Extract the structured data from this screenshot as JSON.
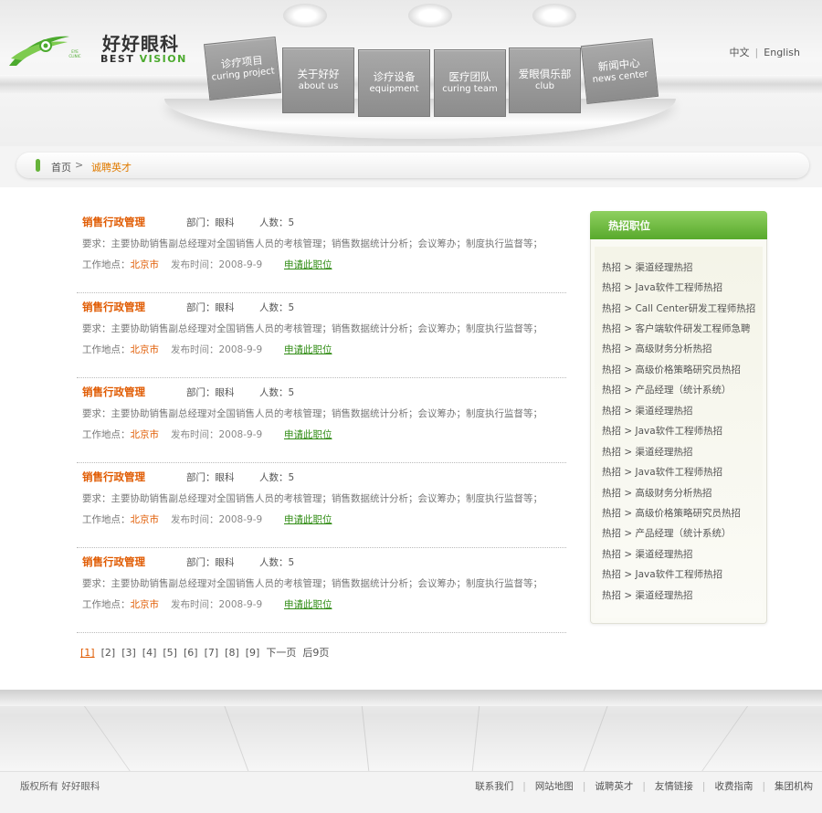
{
  "brand": {
    "name_cn": "好好眼科",
    "name_en_prefix": "BEST ",
    "name_en_accent": "VISION",
    "tiny_mark": "EYE CLINIC"
  },
  "language": {
    "cn": "中文",
    "en": "English",
    "separator": "|"
  },
  "nav": [
    {
      "cn": "诊疗项目",
      "en": "curing project"
    },
    {
      "cn": "关于好好",
      "en": "about us"
    },
    {
      "cn": "诊疗设备",
      "en": "equipment"
    },
    {
      "cn": "医疗团队",
      "en": "curing team"
    },
    {
      "cn": "爱眼俱乐部",
      "en": "club"
    },
    {
      "cn": "新闻中心",
      "en": "news center"
    }
  ],
  "breadcrumb": {
    "home": "首页",
    "arrow": ">",
    "current": "诚聘英才"
  },
  "jobs": [
    {
      "title": "销售行政管理",
      "dept": "部门：眼科",
      "count": "人数：5",
      "requirement": "要求：主要协助销售副总经理对全国销售人员的考核管理；销售数据统计分析；会议筹办；制度执行监督等；",
      "place_label": "工作地点：",
      "place": "北京市",
      "date": "发布时间：2008-9-9",
      "apply": "申请此职位"
    },
    {
      "title": "销售行政管理",
      "dept": "部门：眼科",
      "count": "人数：5",
      "requirement": "要求：主要协助销售副总经理对全国销售人员的考核管理；销售数据统计分析；会议筹办；制度执行监督等；",
      "place_label": "工作地点：",
      "place": "北京市",
      "date": "发布时间：2008-9-9",
      "apply": "申请此职位"
    },
    {
      "title": "销售行政管理",
      "dept": "部门：眼科",
      "count": "人数：5",
      "requirement": "要求：主要协助销售副总经理对全国销售人员的考核管理；销售数据统计分析；会议筹办；制度执行监督等；",
      "place_label": "工作地点：",
      "place": "北京市",
      "date": "发布时间：2008-9-9",
      "apply": "申请此职位"
    },
    {
      "title": "销售行政管理",
      "dept": "部门：眼科",
      "count": "人数：5",
      "requirement": "要求：主要协助销售副总经理对全国销售人员的考核管理；销售数据统计分析；会议筹办；制度执行监督等；",
      "place_label": "工作地点：",
      "place": "北京市",
      "date": "发布时间：2008-9-9",
      "apply": "申请此职位"
    },
    {
      "title": "销售行政管理",
      "dept": "部门：眼科",
      "count": "人数：5",
      "requirement": "要求：主要协助销售副总经理对全国销售人员的考核管理；销售数据统计分析；会议筹办；制度执行监督等；",
      "place_label": "工作地点：",
      "place": "北京市",
      "date": "发布时间：2008-9-9",
      "apply": "申请此职位"
    }
  ],
  "pager": {
    "pages": [
      "[1]",
      "[2]",
      "[3]",
      "[4]",
      "[5]",
      "[6]",
      "[7]",
      "[8]",
      "[9]"
    ],
    "next": "下一页",
    "last": "后9页"
  },
  "sidebar": {
    "title": "热招职位",
    "items": [
      "热招 > 渠道经理热招",
      "热招 > Java软件工程师热招",
      "热招 > Call Center研发工程师热招",
      "热招 > 客户端软件研发工程师急聘",
      "热招 > 高级财务分析热招",
      "热招 > 高级价格策略研究员热招",
      "热招 > 产品经理（统计系统）",
      "热招 > 渠道经理热招",
      "热招 > Java软件工程师热招",
      "热招 > 渠道经理热招",
      "热招 > Java软件工程师热招",
      "热招 > 高级财务分析热招",
      "热招 > 高级价格策略研究员热招",
      "热招 > 产品经理（统计系统）",
      "热招 > 渠道经理热招",
      "热招 > Java软件工程师热招",
      "热招 > 渠道经理热招"
    ]
  },
  "footer": {
    "copyright": "版权所有 好好眼科",
    "links": [
      "联系我们",
      "网站地图",
      "诚聘英才",
      "友情链接",
      "收费指南",
      "集团机构"
    ]
  },
  "colors": {
    "accent_orange": "#e05a00",
    "accent_green": "#58a92c",
    "link_green": "#2e8b12"
  }
}
